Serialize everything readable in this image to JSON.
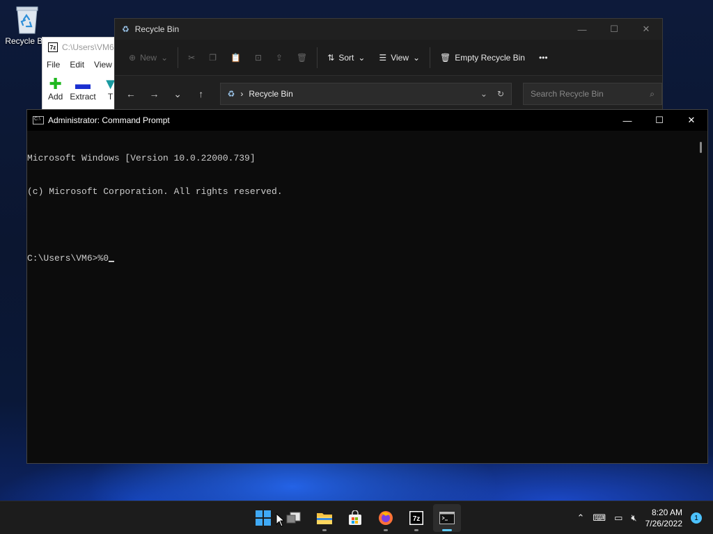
{
  "desktop": {
    "recycle_bin_label": "Recycle Bin"
  },
  "zip_window": {
    "title": "C:\\Users\\VM6",
    "menu": [
      "File",
      "Edit",
      "View"
    ],
    "tools": [
      {
        "label": "Add",
        "icon": "plus-icon"
      },
      {
        "label": "Extract",
        "icon": "minus-icon"
      },
      {
        "label": "T",
        "icon": "test-icon"
      }
    ]
  },
  "explorer": {
    "title": "Recycle Bin",
    "commands": {
      "new": "New",
      "sort": "Sort",
      "view": "View",
      "empty": "Empty Recycle Bin",
      "more": "•••"
    },
    "address": "Recycle Bin",
    "search_placeholder": "Search Recycle Bin"
  },
  "cmd": {
    "title": "Administrator: Command Prompt",
    "lines": [
      "Microsoft Windows [Version 10.0.22000.739]",
      "(c) Microsoft Corporation. All rights reserved.",
      "",
      "C:\\Users\\VM6>%0"
    ]
  },
  "taskbar": {
    "apps": [
      "start",
      "task-view",
      "file-explorer",
      "microsoft-store",
      "firefox",
      "7-zip",
      "command-prompt"
    ],
    "time": "8:20 AM",
    "date": "7/26/2022",
    "notifications": "1"
  },
  "colors": {
    "accent": "#60cdff",
    "console_bg": "#0c0c0c",
    "console_fg": "#cccccc",
    "taskbar_bg": "#1c1c1c"
  }
}
